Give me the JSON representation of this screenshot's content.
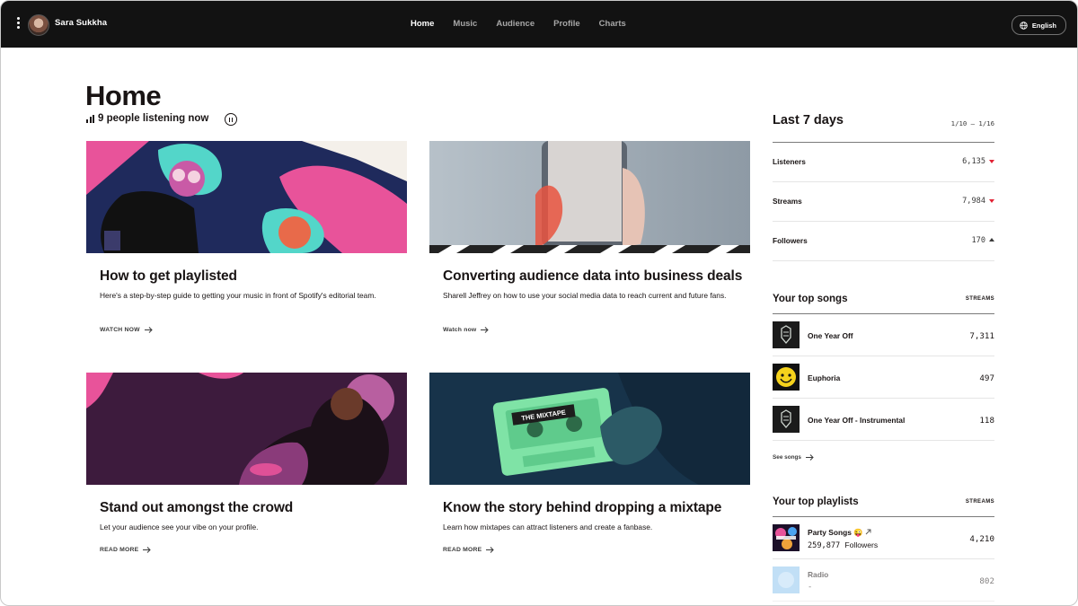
{
  "topbar": {
    "user_name": "Sara Sukkha",
    "nav": [
      {
        "label": "Home",
        "active": true
      },
      {
        "label": "Music",
        "active": false
      },
      {
        "label": "Audience",
        "active": false
      },
      {
        "label": "Profile",
        "active": false
      },
      {
        "label": "Charts",
        "active": false
      }
    ],
    "language": "English"
  },
  "main": {
    "title": "Home",
    "listening": "9 people listening now",
    "cards": [
      {
        "title": "How to get playlisted",
        "desc": "Here's a step-by-step guide to getting your music in front of Spotify's editorial team.",
        "cta": "WATCH NOW"
      },
      {
        "title": "Converting audience data into business deals",
        "desc": "Sharell Jeffrey on how to use your social media data to reach current and future fans.",
        "cta": "Watch now"
      },
      {
        "title": "Stand out amongst the crowd",
        "desc": "Let your audience see your vibe on your profile.",
        "cta": "READ MORE"
      },
      {
        "title": "Know the story behind dropping a mixtape",
        "desc": "Learn how mixtapes can attract listeners and create a fanbase.",
        "cta": "READ MORE",
        "image_text": "THE MIXTAPE"
      }
    ]
  },
  "sidebar": {
    "period_title": "Last 7 days",
    "period_range": "1/10 – 1/16",
    "stats": [
      {
        "label": "Listeners",
        "value": "6,135",
        "trend": "down"
      },
      {
        "label": "Streams",
        "value": "7,984",
        "trend": "down"
      },
      {
        "label": "Followers",
        "value": "170",
        "trend": "up"
      }
    ],
    "top_songs": {
      "title": "Your top songs",
      "column": "STREAMS",
      "items": [
        {
          "name": "One Year Off",
          "streams": "7,311"
        },
        {
          "name": "Euphoria",
          "streams": "497"
        },
        {
          "name": "One Year Off - Instrumental",
          "streams": "118"
        }
      ],
      "see_more": "See songs"
    },
    "top_playlists": {
      "title": "Your top playlists",
      "column": "STREAMS",
      "items": [
        {
          "name": "Party Songs 😜",
          "followers_count": "259,877",
          "followers_word": "Followers",
          "streams": "4,210"
        },
        {
          "name": "Radio",
          "followers_count": "-",
          "streams": "802"
        }
      ]
    }
  },
  "colors": {
    "topbar": "#121212",
    "trend_down": "#e22134",
    "text": "#191414"
  }
}
